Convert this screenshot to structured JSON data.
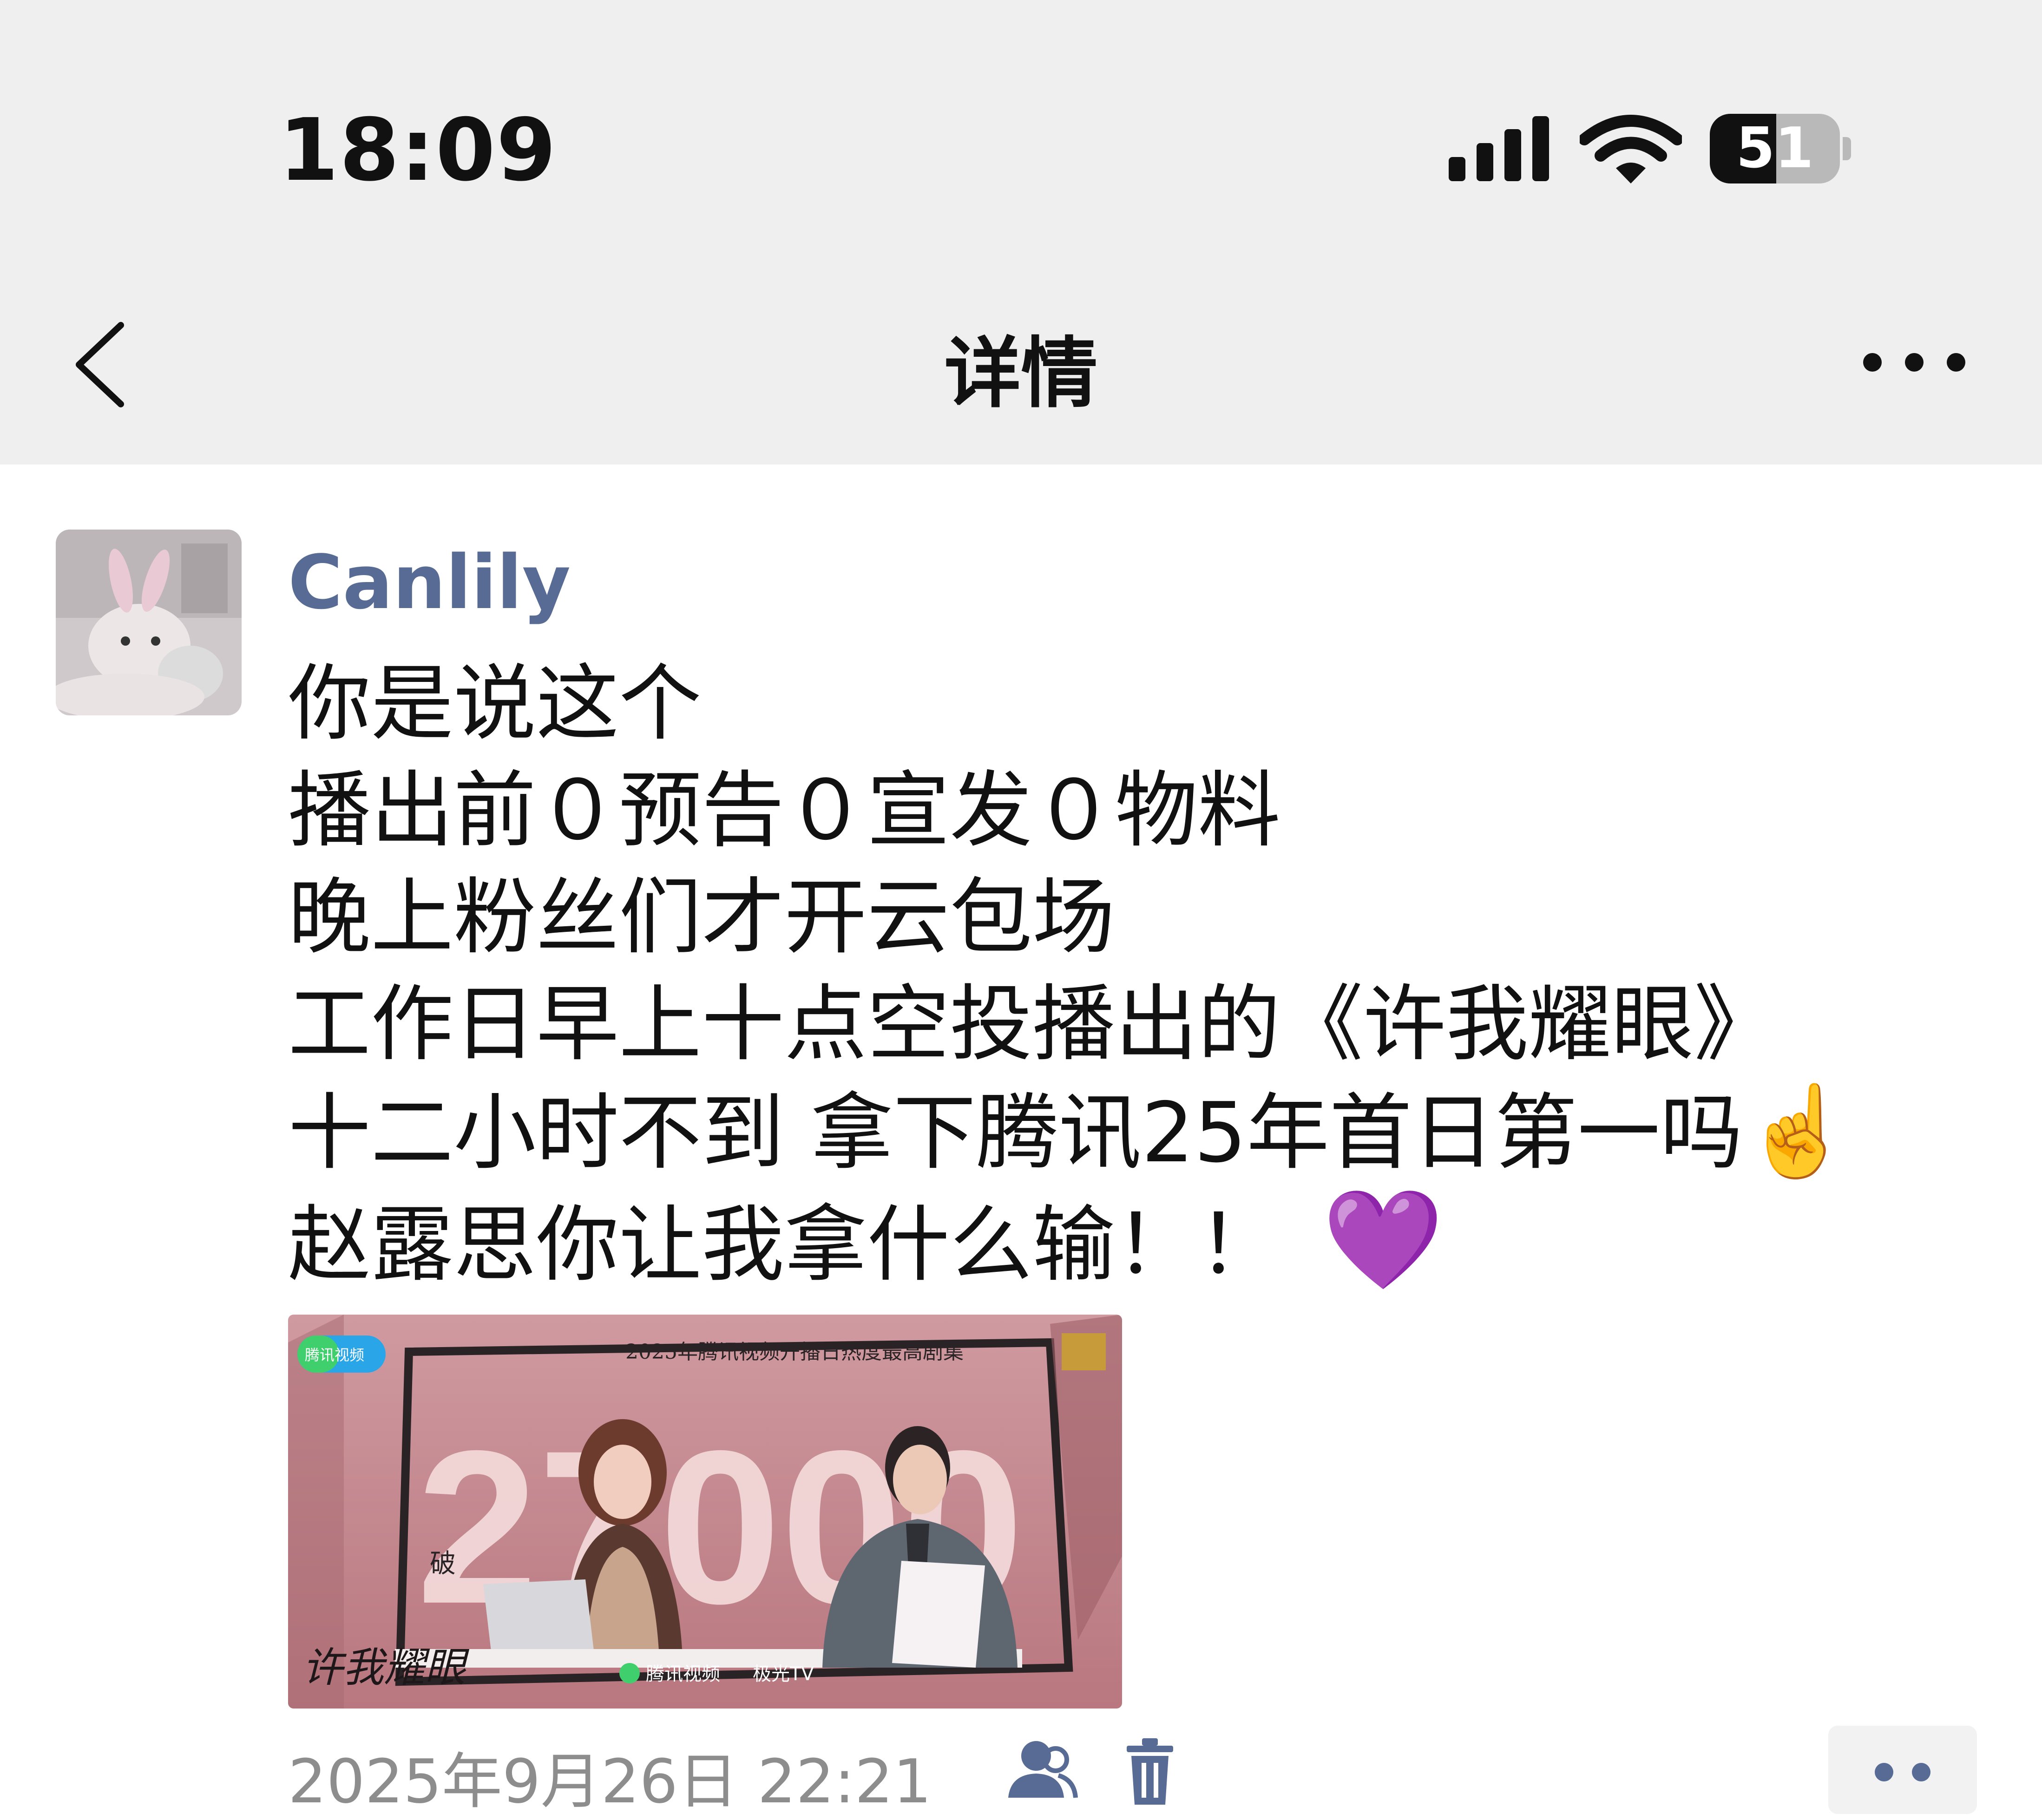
{
  "status_bar": {
    "time": "18:09",
    "battery_level": "51",
    "signal_icon": "cellular-signal-icon",
    "wifi_icon": "wifi-icon"
  },
  "nav": {
    "title": "详情",
    "back_icon": "chevron-left-icon",
    "more_icon": "ellipsis-icon"
  },
  "post": {
    "author": "Canlily",
    "lines": [
      "你是说这个",
      "播出前０预告０宣发０物料",
      "晚上粉丝们才开云包场",
      "工作日早上十点空投播出的《许我耀眼》",
      "十二小时不到 拿下腾讯25年首日第一吗",
      "赵露思你让我拿什么输！！"
    ],
    "emoji_hand": "☝️",
    "emoji_heart": "💜",
    "image": {
      "logo_text": "腾讯视频",
      "header_text": "2025年腾讯视频开播日热度最高剧集",
      "big_number": "27000",
      "side_char": "破",
      "bottom_brand": "腾讯视频",
      "bottom_brand2": "极光TV",
      "calligraphy_title": "许我耀眼"
    },
    "timestamp": "2025年9月26日 22:21",
    "friends_icon": "friends-visibility-icon",
    "delete_icon": "trash-icon",
    "comment_icon": "comment-more-icon"
  },
  "colors": {
    "nav_background": "#efefef",
    "username": "#576b95",
    "timestamp": "#8d8d8d",
    "poster_pink": "#c98a91"
  }
}
